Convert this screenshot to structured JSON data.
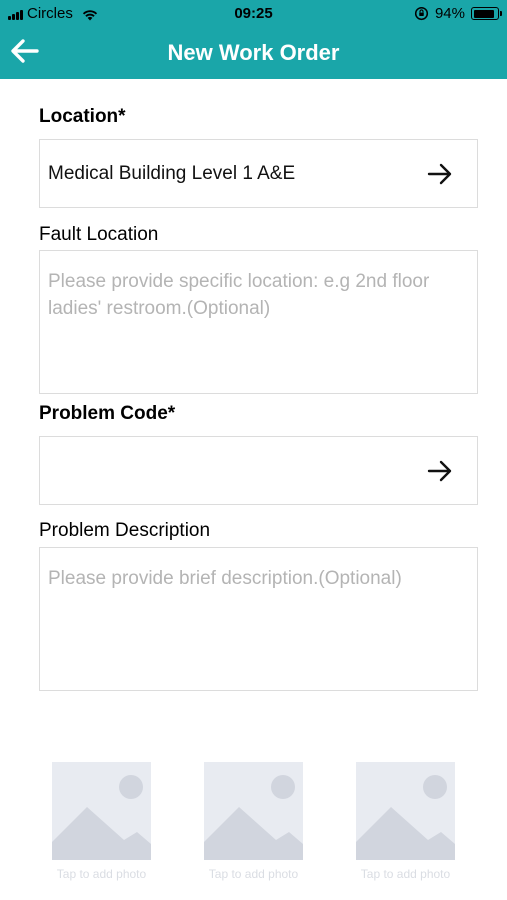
{
  "status_bar": {
    "carrier": "Circles",
    "time": "09:25",
    "battery_percent": "94%",
    "battery_level": 0.94
  },
  "header": {
    "title": "New Work Order",
    "background_color": "#1aa6a9"
  },
  "form": {
    "location": {
      "label": "Location*",
      "value": "Medical Building Level 1 A&E"
    },
    "fault_location": {
      "label": "Fault Location",
      "placeholder": "Please provide specific location: e.g 2nd floor ladies' restroom.(Optional)",
      "value": ""
    },
    "problem_code": {
      "label": "Problem Code*",
      "value": ""
    },
    "problem_description": {
      "label": "Problem Description",
      "placeholder": "Please provide brief description.(Optional)",
      "value": ""
    }
  },
  "photos": [
    {
      "label": "Tap to add photo",
      "icon": "image-placeholder-icon"
    },
    {
      "label": "Tap to add photo",
      "icon": "image-placeholder-icon"
    },
    {
      "label": "Tap to add photo",
      "icon": "image-placeholder-icon"
    }
  ]
}
